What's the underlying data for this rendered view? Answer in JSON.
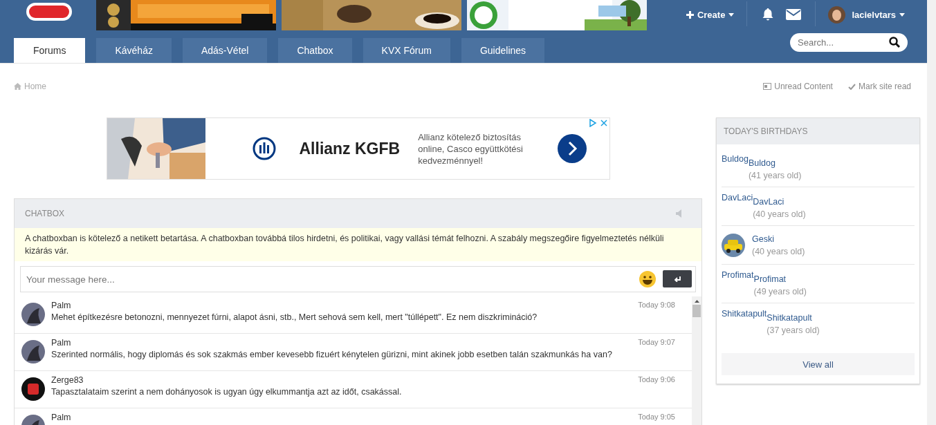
{
  "header": {
    "create": "Create",
    "user": "lacielvtars"
  },
  "tabs": [
    {
      "label": "Forums",
      "selected": true
    },
    {
      "label": "Kávéház",
      "selected": false
    },
    {
      "label": "Adás-Vétel",
      "selected": false
    },
    {
      "label": "Chatbox",
      "selected": false
    },
    {
      "label": "KVX Fórum",
      "selected": false
    },
    {
      "label": "Guidelines",
      "selected": false
    }
  ],
  "search": {
    "placeholder": "Search..."
  },
  "breadcrumb": "Home",
  "actions": [
    "Unread Content",
    "Mark site read"
  ],
  "ad": {
    "brand": "Allianz KGFB",
    "text": "Allianz kötelező biztosítás online, Casco együttkötési kedvezménnyel!"
  },
  "chatbox": {
    "title": "CHATBOX",
    "notice": "A chatboxban is kötelező a netikett betartása. A chatboxban továbbá tilos hirdetni, és politikai, vagy vallási témát felhozni. A szabály megszegőire figyelmeztetés nélküli kizárás vár.",
    "input": {
      "placeholder": "Your message here..."
    },
    "messages": [
      {
        "user": "Palm",
        "time": "Today 9:08",
        "text": "Mehet építkezésre betonozni, mennyezet fúrni, alapot ásni, stb., Mert sehová sem kell, mert \"túllépett\". Ez nem diszkrimináció?"
      },
      {
        "user": "Palm",
        "time": "Today 9:07",
        "text": "Szerinted normális, hogy diplomás és sok szakmás ember kevesebb fizuért kénytelen gürizni, mint akinek jobb esetben talán szakmunkás ha van?"
      },
      {
        "user": "Zerge83",
        "time": "Today 9:06",
        "text": "Tapasztalataim szerint a nem dohányosok is ugyan úgy elkummantja azt az időt, csakással."
      },
      {
        "user": "Palm",
        "time": "Today 9:05"
      }
    ]
  },
  "birthdays": {
    "title": "TODAY'S BIRTHDAYS",
    "people": [
      {
        "avatar_alt": "Buldog",
        "name": "Buldog",
        "age": "(41 years old)"
      },
      {
        "avatar_alt": "DavLaci",
        "name": "DavLaci",
        "age": "(40 years old)"
      },
      {
        "name": "Geski",
        "age": "(40 years old)"
      },
      {
        "avatar_alt": "Profimat",
        "name": "Profimat",
        "age": "(49 years old)"
      },
      {
        "avatar_alt": "Shitkatapult",
        "name": "Shitkatapult",
        "age": "(37 years old)"
      }
    ],
    "view_all": "View all"
  }
}
